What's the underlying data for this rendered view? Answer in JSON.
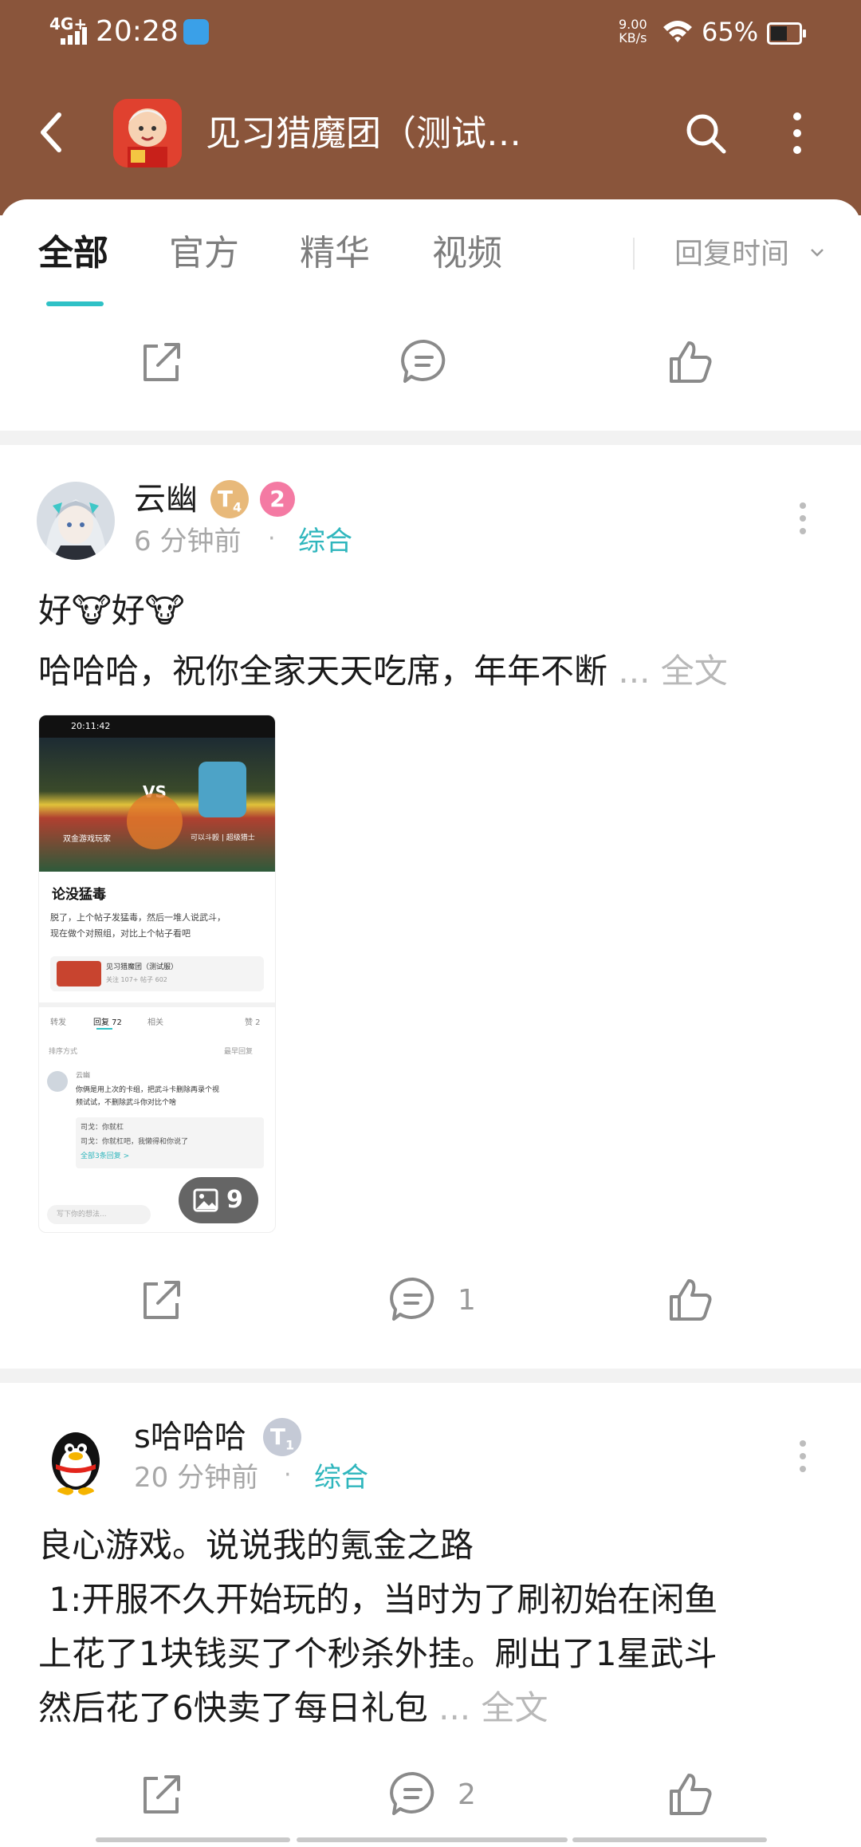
{
  "status_bar": {
    "network": "4G+",
    "time": "20:28",
    "speed": "9.00",
    "speed_unit": "KB/s",
    "battery": "65%"
  },
  "header": {
    "title": "见习猎魔团（测试…"
  },
  "tabs": [
    {
      "label": "全部",
      "active": true
    },
    {
      "label": "官方",
      "active": false
    },
    {
      "label": "精华",
      "active": false
    },
    {
      "label": "视频",
      "active": false
    }
  ],
  "sort": {
    "label": "回复时间"
  },
  "posts": [
    {
      "author": "云幽",
      "badge_t": "T",
      "badge_t_sub": "4",
      "level": "2",
      "time": "6 分钟前",
      "category": "综合",
      "lines": [
        "好🐮好🐮",
        "哈哈哈，祝你全家天天吃席，年年不断"
      ],
      "more": "... 全文",
      "image_count": "9",
      "comments": "1"
    },
    {
      "author": "s哈哈哈",
      "badge_t": "T",
      "badge_t_sub": "1",
      "time": "20 分钟前",
      "category": "综合",
      "lines": [
        "良心游戏。说说我的氪金之路",
        " 1:开服不久开始玩的，当时为了刷初始在闲鱼",
        "上花了1块钱买了个秒杀外挂。刷出了1星武斗",
        "然后花了6快卖了每日礼包"
      ],
      "more": "... 全文",
      "comments": "2"
    }
  ],
  "screenshot_thumb": {
    "time": "20:11:42",
    "vs": "VS",
    "left_name": "双金游戏玩家",
    "right_name": "可以斗殴 | 超级猎士",
    "title": "论没猛毒",
    "body1": "脱了，上个帖子发猛毒，然后一堆人说武斗，",
    "body2": "现在做个对照组，对比上个帖子看吧",
    "card_name": "见习猎魔团（测试服）",
    "card_meta": "关注 107+  帖子 602",
    "tab_forward": "转发",
    "tab_reply": "回复 72",
    "tab_related": "相关",
    "tab_likes": "赞 2",
    "sort_label": "排序方式",
    "sort_value": "最早回复",
    "c_user": "云幽",
    "c_text1": "你俩是用上次的卡组，把武斗卡删除再录个视",
    "c_text2": "频试试，不删除武斗你对比个啥",
    "r1": "司戈：你就杠",
    "r2": "司戈：你就杠吧，我懒得和你说了",
    "r_all": "全部3条回复 >",
    "input": "写下你的想法..."
  }
}
